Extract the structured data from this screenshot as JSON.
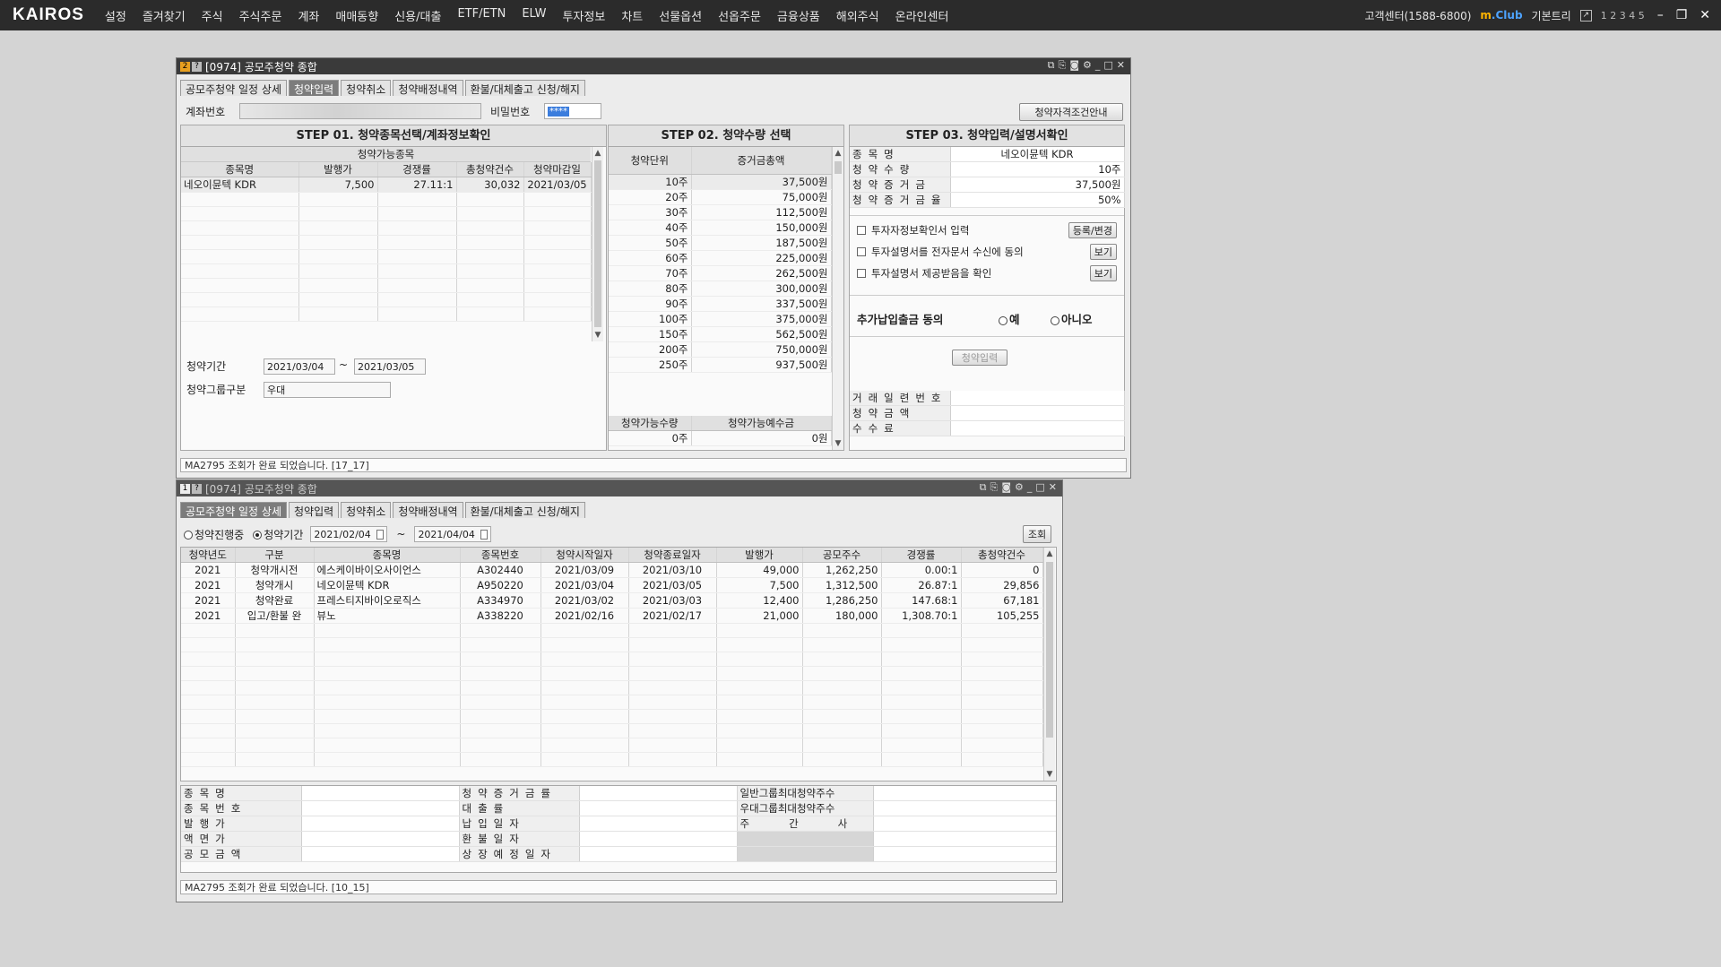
{
  "app": {
    "logo": "KAIROS"
  },
  "topmenu": [
    "설정",
    "즐겨찾기",
    "주식",
    "주식주문",
    "계좌",
    "매매동향",
    "신용/대출",
    "ETF/ETN",
    "ELW",
    "투자정보",
    "차트",
    "선물옵션",
    "선옵주문",
    "금융상품",
    "해외주식",
    "온라인센터"
  ],
  "topright": {
    "customer": "고객센터(1588-6800)",
    "mclub_m": "m",
    "mclub": ".Club",
    "basic": "기본트리",
    "pages": "1 2 3 4 5",
    "current_page": 2
  },
  "win1": {
    "badge1": "2",
    "badge2": "?",
    "title": "[0974] 공모주청약 종합",
    "tabs": [
      "공모주청약 일정 상세",
      "청약입력",
      "청약취소",
      "청약배정내역",
      "환불/대체출고 신청/해지"
    ],
    "active_tab": 1,
    "account_label": "계좌번호",
    "password_label": "비밀번호",
    "password_value": "****",
    "guide_button": "청약자격조건안내",
    "step1": {
      "title": "STEP 01. 청약종목선택/계좌정보확인",
      "subheader": "청약가능종목",
      "columns": [
        "종목명",
        "발행가",
        "경쟁률",
        "총청약건수",
        "청약마감일"
      ],
      "rows": [
        [
          "네오이뮨텍 KDR",
          "7,500",
          "27.11:1",
          "30,032",
          "2021/03/05"
        ]
      ],
      "period_label": "청약기간",
      "period_from": "2021/03/04",
      "period_tilde": "~",
      "period_to": "2021/03/05",
      "group_label": "청약그룹구분",
      "group_value": "우대"
    },
    "step2": {
      "title": "STEP 02. 청약수량 선택",
      "columns": [
        "청약단위",
        "증거금총액"
      ],
      "rows": [
        [
          "10주",
          "37,500원"
        ],
        [
          "20주",
          "75,000원"
        ],
        [
          "30주",
          "112,500원"
        ],
        [
          "40주",
          "150,000원"
        ],
        [
          "50주",
          "187,500원"
        ],
        [
          "60주",
          "225,000원"
        ],
        [
          "70주",
          "262,500원"
        ],
        [
          "80주",
          "300,000원"
        ],
        [
          "90주",
          "337,500원"
        ],
        [
          "100주",
          "375,000원"
        ],
        [
          "150주",
          "562,500원"
        ],
        [
          "200주",
          "750,000원"
        ],
        [
          "250주",
          "937,500원"
        ]
      ],
      "avail_columns": [
        "청약가능수량",
        "청약가능예수금"
      ],
      "avail_values": [
        "0주",
        "0원"
      ]
    },
    "step3": {
      "title": "STEP 03. 청약입력/설명서확인",
      "info": [
        [
          "종목명",
          "네오이뮨텍 KDR"
        ],
        [
          "청약수량",
          "10주"
        ],
        [
          "청약증거금",
          "37,500원"
        ],
        [
          "청약증거금율",
          "50%"
        ]
      ],
      "checks": [
        {
          "label": "투자자정보확인서 입력",
          "button": "등록/변경"
        },
        {
          "label": "투자설명서를 전자문서 수신에 동의",
          "button": "보기"
        },
        {
          "label": "투자설명서 제공받음을 확인",
          "button": "보기"
        }
      ],
      "consent_label": "추가납입출금 동의",
      "consent_yes": "예",
      "consent_no": "아니오",
      "submit_button": "청약입력",
      "result": [
        [
          "거래일련번호",
          ""
        ],
        [
          "청약금액",
          ""
        ],
        [
          "수수료",
          ""
        ]
      ]
    },
    "status": "MA2795 조회가 완료 되었습니다. [17_17]"
  },
  "win2": {
    "badge1": "1",
    "badge2": "?",
    "title": "[0974] 공모주청약 종합",
    "tabs": [
      "공모주청약 일정 상세",
      "청약입력",
      "청약취소",
      "청약배정내역",
      "환불/대체출고 신청/해지"
    ],
    "active_tab": 0,
    "filter_ongoing": "청약진행중",
    "filter_period": "청약기간",
    "date_from": "2021/02/04",
    "tilde": "~",
    "date_to": "2021/04/04",
    "search_button": "조회",
    "columns": [
      "청약년도",
      "구분",
      "종목명",
      "종목번호",
      "청약시작일자",
      "청약종료일자",
      "발행가",
      "공모주수",
      "경쟁률",
      "총청약건수"
    ],
    "rows": [
      [
        "2021",
        "청약개시전",
        "에스케이바이오사이언스",
        "A302440",
        "2021/03/09",
        "2021/03/10",
        "49,000",
        "1,262,250",
        "0.00:1",
        "0"
      ],
      [
        "2021",
        "청약개시",
        "네오이뮨텍 KDR",
        "A950220",
        "2021/03/04",
        "2021/03/05",
        "7,500",
        "1,312,500",
        "26.87:1",
        "29,856"
      ],
      [
        "2021",
        "청약완료",
        "프레스티지바이오로직스",
        "A334970",
        "2021/03/02",
        "2021/03/03",
        "12,400",
        "1,286,250",
        "147.68:1",
        "67,181"
      ],
      [
        "2021",
        "입고/환불 완",
        "뷰노",
        "A338220",
        "2021/02/16",
        "2021/02/17",
        "21,000",
        "180,000",
        "1,308.70:1",
        "105,255"
      ]
    ],
    "detail_col1": [
      "종목명",
      "종목번호",
      "발행가",
      "액면가",
      "공모금액"
    ],
    "detail_col2": [
      "청약증거금률",
      "대출률",
      "납입일자",
      "환불일자",
      "상장예정일자"
    ],
    "detail_col3": [
      "일반그룹최대청약주수",
      "우대그룹최대청약주수",
      "주간사"
    ],
    "status": "MA2795 조회가 완료 되었습니다. [10_15]"
  },
  "colors": {
    "topbar": "#2b2b2b",
    "active_tab": "#7c7c7c",
    "badge": "#e8a020",
    "mclub": "#4da3ff"
  }
}
